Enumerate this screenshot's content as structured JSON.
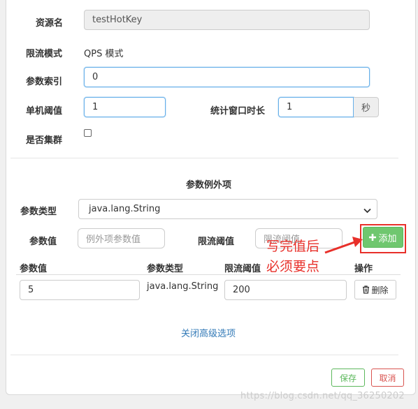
{
  "form": {
    "resource_label": "资源名",
    "resource_value": "testHotKey",
    "mode_label": "限流模式",
    "mode_value": "QPS 模式",
    "param_index_label": "参数索引",
    "param_index_value": "0",
    "threshold_label": "单机阈值",
    "threshold_value": "1",
    "window_label": "统计窗口时长",
    "window_value": "1",
    "window_unit": "秒",
    "cluster_label": "是否集群"
  },
  "exceptions": {
    "section_title": "参数例外项",
    "param_type_label": "参数类型",
    "param_type_value": "java.lang.String",
    "param_value_label": "参数值",
    "param_value_placeholder": "例外项参数值",
    "limit_label": "限流阈值",
    "limit_placeholder": "限流阈值",
    "add_button": "添加",
    "table_headers": [
      "参数值",
      "参数类型",
      "限流阈值",
      "操作"
    ],
    "rows": [
      {
        "value": "5",
        "type": "java.lang.String",
        "limit": "200",
        "action": "删除"
      }
    ],
    "close_advanced": "关闭高级选项"
  },
  "annotation": {
    "line1": "写完值后",
    "line2": "必须要点"
  },
  "footer": {
    "save": "保存",
    "cancel": "取消"
  },
  "watermark": "https://blog.csdn.net/qq_36250202",
  "colors": {
    "primary_blue": "#337ab7",
    "success_green": "#5cb85c",
    "danger_red": "#d9534f",
    "annotation_red": "#e8302a",
    "focus_blue": "#66afe9"
  },
  "icons": {
    "add": "plus-icon",
    "delete": "trash-icon",
    "select": "chevron-down-icon"
  }
}
